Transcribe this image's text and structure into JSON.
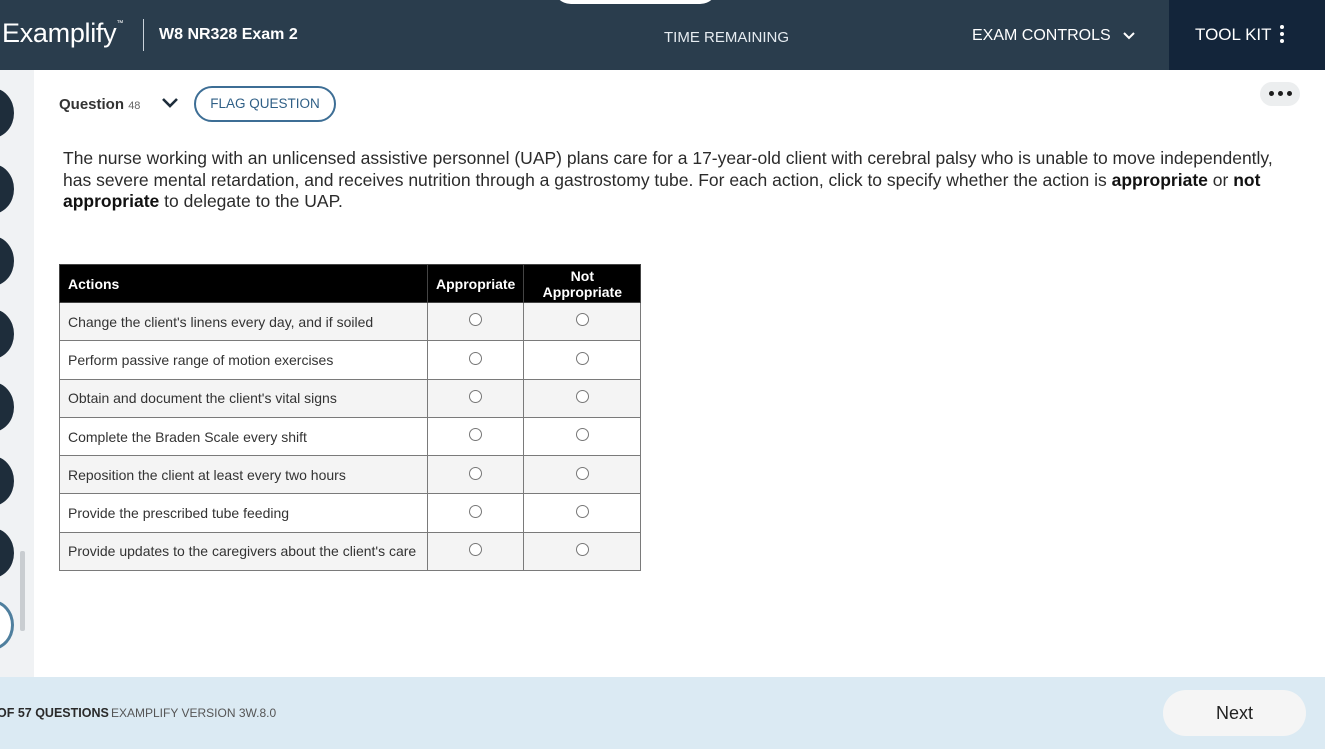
{
  "header": {
    "logo": "Examplify",
    "logo_mark": "™",
    "exam_title": "W8 NR328 Exam 2",
    "time_label": "TIME REMAINING",
    "exam_controls_label": "EXAM CONTROLS",
    "toolkit_label": "TOOL KIT"
  },
  "question": {
    "label": "Question",
    "number": "48",
    "flag_label": "FLAG QUESTION",
    "stem_part1": "The nurse working with an unlicensed assistive personnel (UAP) plans care for a 17-year-old client with cerebral palsy who is unable to move independently, has severe mental retardation, and receives nutrition through a gastrostomy tube. For each action, click to specify whether the action is ",
    "stem_bold1": "appropriate",
    "stem_part2": " or ",
    "stem_bold2": "not appropriate",
    "stem_part3": " to delegate to the UAP."
  },
  "table": {
    "headers": [
      "Actions",
      "Appropriate",
      "Not Appropriate"
    ],
    "rows": [
      "Change the client's linens every day, and if soiled",
      "Perform passive range of motion exercises",
      "Obtain and document the client's vital signs",
      "Complete the Braden Scale every shift",
      "Reposition the client at least every two hours",
      "Provide the prescribed tube feeding",
      "Provide updates to the caregivers about the client's care"
    ]
  },
  "footer": {
    "progress": "OF 57 QUESTIONS",
    "version": "EXAMPLIFY VERSION 3W.8.0",
    "next_label": "Next"
  },
  "colors": {
    "header_bg": "#2a3d4d",
    "toolkit_bg": "#13253a",
    "footer_bg": "#dbeaf3",
    "accent": "#3d6e95"
  }
}
